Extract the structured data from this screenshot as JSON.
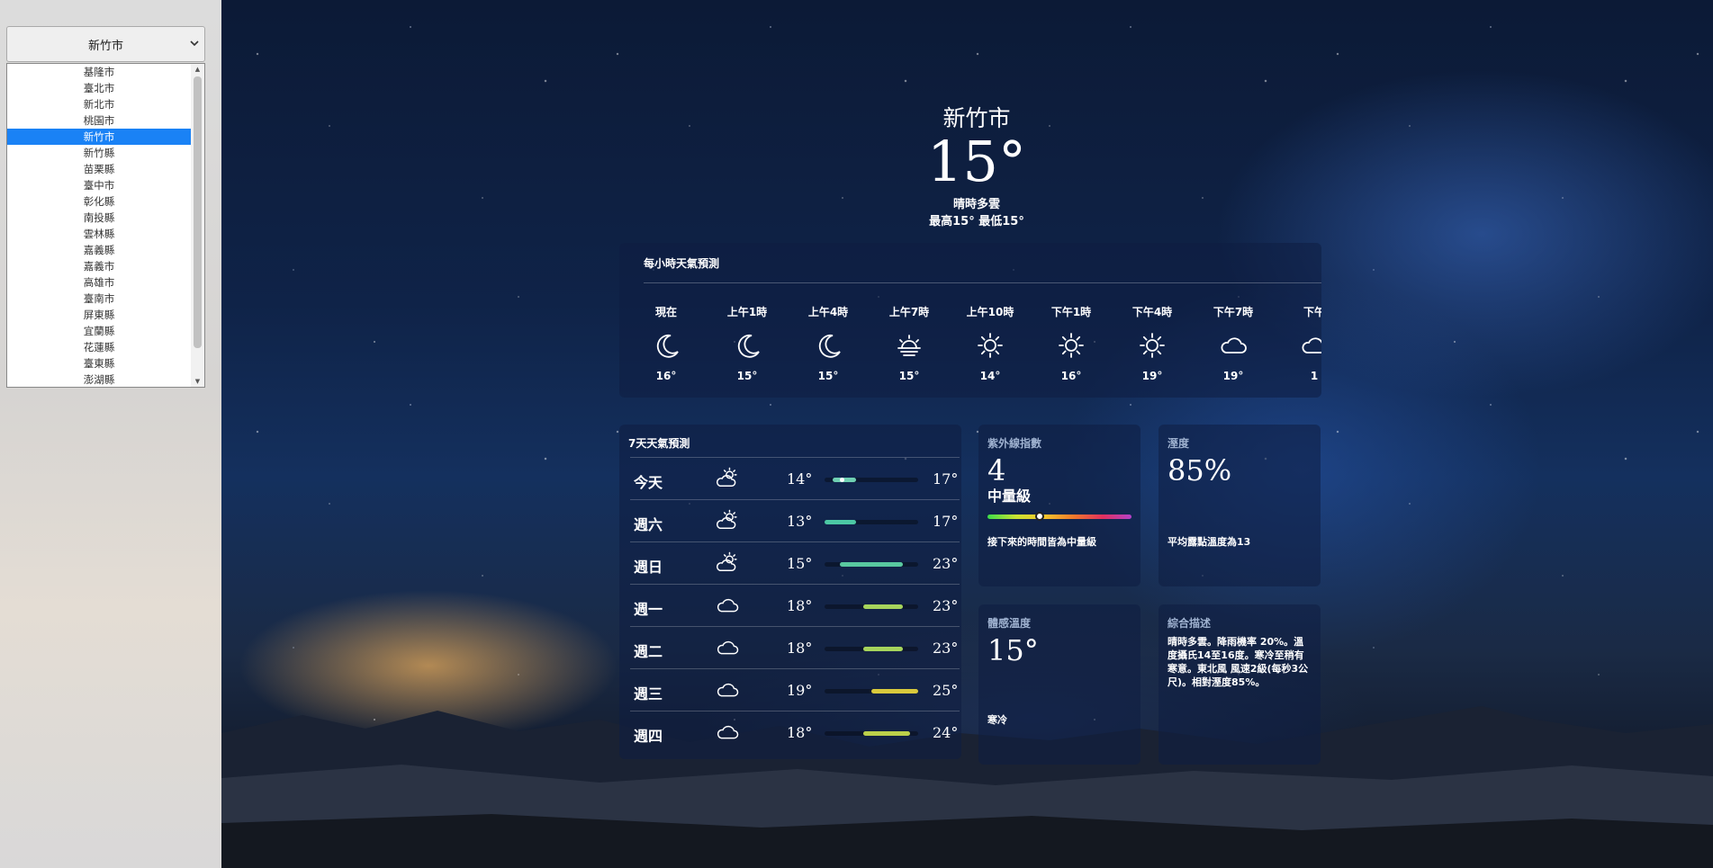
{
  "city_selector": {
    "selected": "新竹市",
    "options": [
      "基隆市",
      "臺北市",
      "新北市",
      "桃園市",
      "新竹市",
      "新竹縣",
      "苗栗縣",
      "臺中市",
      "彰化縣",
      "南投縣",
      "雲林縣",
      "嘉義縣",
      "嘉義市",
      "高雄市",
      "臺南市",
      "屏東縣",
      "宜蘭縣",
      "花蓮縣",
      "臺東縣",
      "澎湖縣"
    ],
    "selected_index": 4
  },
  "current": {
    "city": "新竹市",
    "temp": "15°",
    "description": "晴時多雲",
    "hilo": "最高15° 最低15°"
  },
  "hourly": {
    "title": "每小時天氣預測",
    "items": [
      {
        "time": "現在",
        "icon": "moon-icon",
        "temp": "16°"
      },
      {
        "time": "上午1時",
        "icon": "moon-icon",
        "temp": "15°"
      },
      {
        "time": "上午4時",
        "icon": "moon-icon",
        "temp": "15°"
      },
      {
        "time": "上午7時",
        "icon": "sunrise-icon",
        "temp": "15°"
      },
      {
        "time": "上午10時",
        "icon": "sun-icon",
        "temp": "14°"
      },
      {
        "time": "下午1時",
        "icon": "sun-icon",
        "temp": "16°"
      },
      {
        "time": "下午4時",
        "icon": "sun-icon",
        "temp": "19°"
      },
      {
        "time": "下午7時",
        "icon": "cloud-icon",
        "temp": "19°"
      },
      {
        "time": "下午",
        "icon": "cloud-icon",
        "temp": "1"
      }
    ]
  },
  "daily": {
    "title": "7天天氣預測",
    "range_min": 13,
    "range_max": 25,
    "days": [
      {
        "name": "今天",
        "icon": "partly-sunny-icon",
        "lo": "14°",
        "hi": "17°",
        "lo_v": 14,
        "hi_v": 17,
        "color": "#6fd0b3",
        "current_dot": true
      },
      {
        "name": "週六",
        "icon": "partly-sunny-icon",
        "lo": "13°",
        "hi": "17°",
        "lo_v": 13,
        "hi_v": 17,
        "color": "#4cc7a4"
      },
      {
        "name": "週日",
        "icon": "partly-sunny-icon",
        "lo": "15°",
        "hi": "23°",
        "lo_v": 15,
        "hi_v": 23,
        "color": "#59c9a0"
      },
      {
        "name": "週一",
        "icon": "cloud-icon",
        "lo": "18°",
        "hi": "23°",
        "lo_v": 18,
        "hi_v": 23,
        "color": "#a6d45c"
      },
      {
        "name": "週二",
        "icon": "cloud-icon",
        "lo": "18°",
        "hi": "23°",
        "lo_v": 18,
        "hi_v": 23,
        "color": "#a6d45c"
      },
      {
        "name": "週三",
        "icon": "cloud-icon",
        "lo": "19°",
        "hi": "25°",
        "lo_v": 19,
        "hi_v": 25,
        "color": "#d9c93c"
      },
      {
        "name": "週四",
        "icon": "cloud-icon",
        "lo": "18°",
        "hi": "24°",
        "lo_v": 18,
        "hi_v": 24,
        "color": "#bcd04a"
      }
    ]
  },
  "uv": {
    "title": "紫外線指數",
    "value": "4",
    "level": "中量級",
    "note": "接下來的時間皆為中量級",
    "index": 4,
    "scale_max": 11
  },
  "humidity": {
    "title": "溼度",
    "value": "85%",
    "note": "平均露點溫度為13"
  },
  "feels_like": {
    "title": "體感溫度",
    "value": "15°",
    "note": "寒冷"
  },
  "summary": {
    "title": "綜合描述",
    "text": "晴時多雲。降雨機率 20%。溫度攝氏14至16度。寒冷至稍有寒意。東北風 風速2級(每秒3公尺)。相對溼度85%。"
  }
}
